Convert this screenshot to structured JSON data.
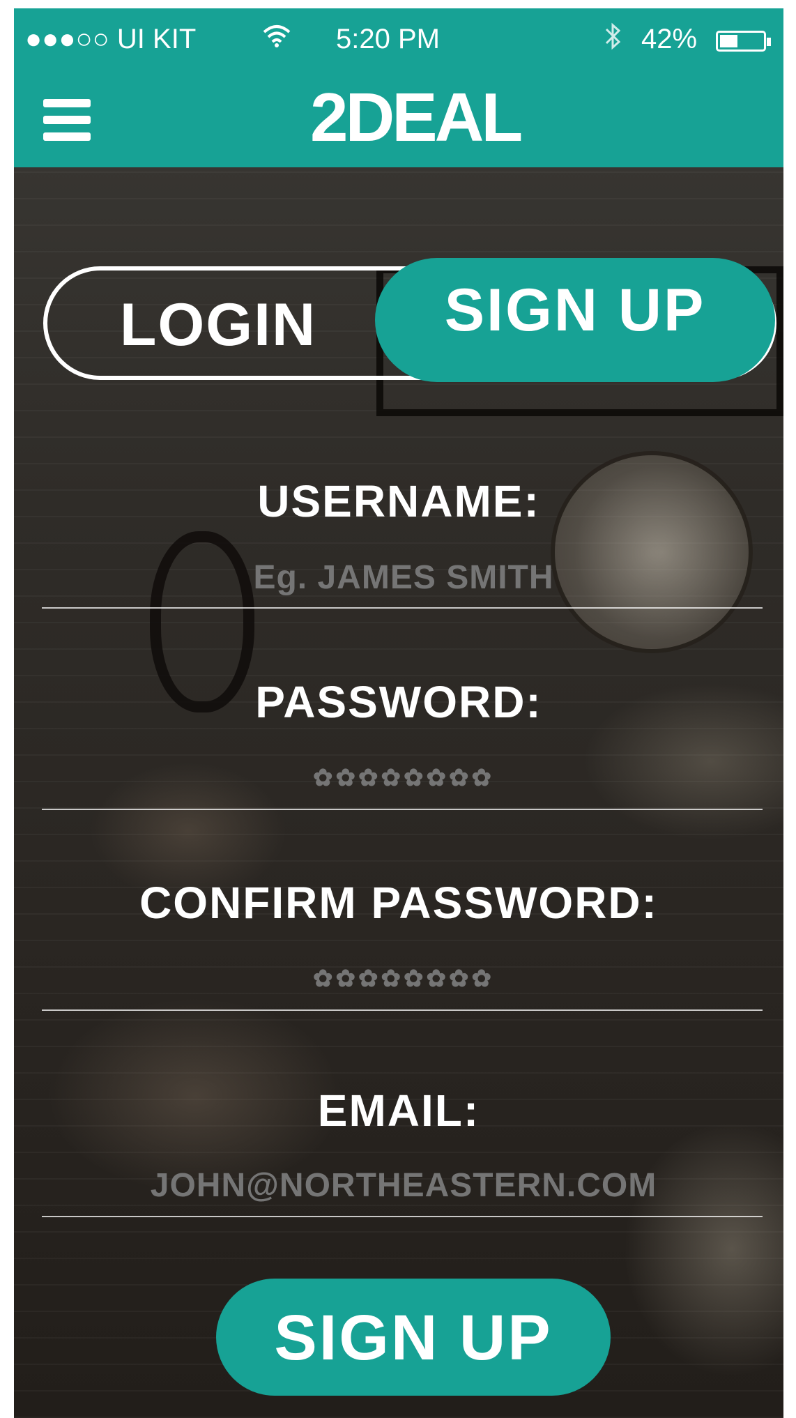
{
  "colors": {
    "accent": "#17a295",
    "text": "#ffffff"
  },
  "status_bar": {
    "carrier": "●●●○○ UI KIT",
    "wifi_icon": "wifi-icon",
    "time": "5:20 PM",
    "bluetooth_icon": "bluetooth-icon",
    "battery_percent": "42%",
    "battery_level": 0.42
  },
  "header": {
    "menu_icon": "hamburger-menu-icon",
    "logo_text": "2DEAL"
  },
  "tabs": {
    "login_label": "LOGIN",
    "signup_label": "SIGN UP",
    "active": "SIGN UP"
  },
  "form": {
    "username": {
      "label": "USERNAME:",
      "placeholder": "Eg. JAMES SMITH"
    },
    "password": {
      "label": "PASSWORD:",
      "placeholder": "✿✿✿✿✿✿✿✿"
    },
    "confirm_password": {
      "label": "CONFIRM PASSWORD:",
      "placeholder": "✿✿✿✿✿✿✿✿"
    },
    "email": {
      "label": "EMAIL:",
      "placeholder": "JOHN@NORTHEASTERN.COM"
    }
  },
  "submit": {
    "label": "SIGN UP"
  }
}
